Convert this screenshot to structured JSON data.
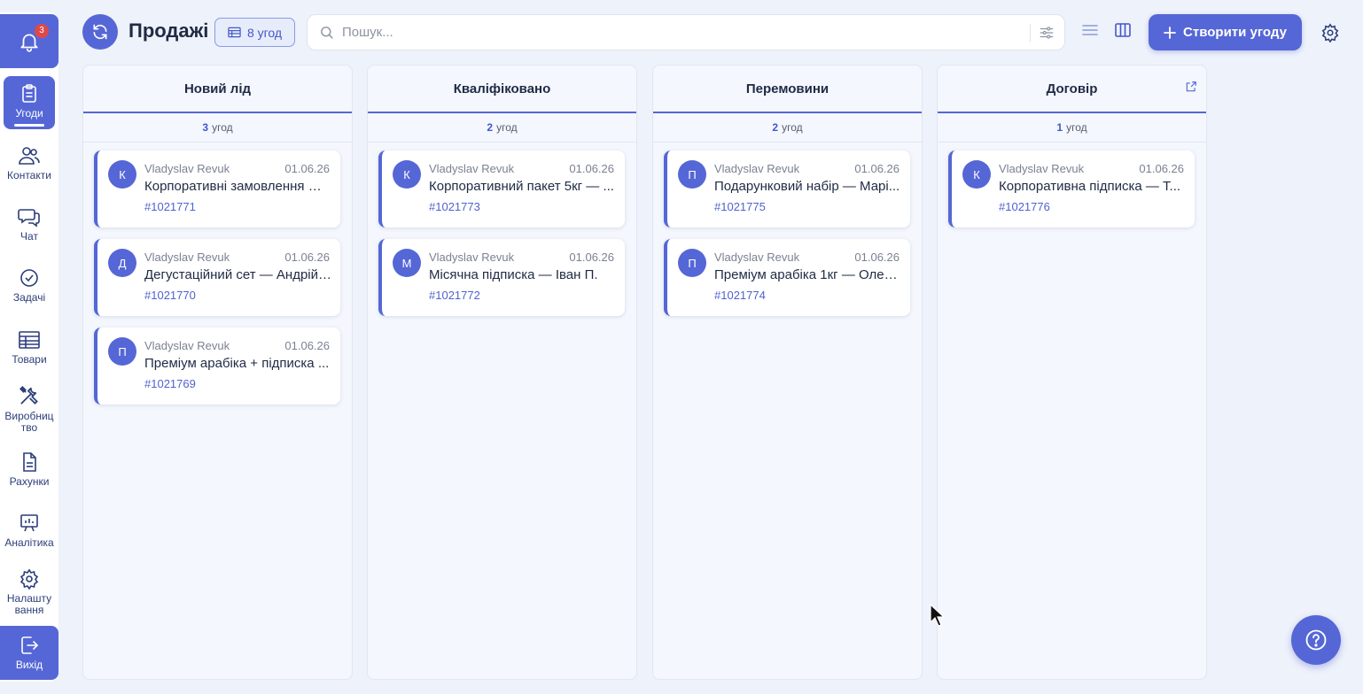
{
  "sidebar": {
    "notifications_count": "3",
    "items": [
      {
        "label": "Угоди"
      },
      {
        "label": "Контакти"
      },
      {
        "label": "Чат"
      },
      {
        "label": "Задачі"
      },
      {
        "label": "Товари"
      },
      {
        "label": "Виробниц тво"
      },
      {
        "label": "Рахунки"
      },
      {
        "label": "Аналітика"
      },
      {
        "label": "Налашту вання"
      }
    ],
    "exit_label": "Вихід"
  },
  "header": {
    "title": "Продажі",
    "deals_count": "8 угод",
    "search_placeholder": "Пошук...",
    "create_label": "Створити угоду"
  },
  "columns": [
    {
      "title": "Новий лід",
      "count": "3",
      "count_unit": "угод",
      "cards": [
        {
          "initial": "К",
          "owner": "Vladyslav Revuk",
          "date": "01.06.26",
          "title": "Корпоративні замовлення — ...",
          "number": "#1021771"
        },
        {
          "initial": "Д",
          "owner": "Vladyslav Revuk",
          "date": "01.06.26",
          "title": "Дегустаційний сет — Андрій ...",
          "number": "#1021770"
        },
        {
          "initial": "П",
          "owner": "Vladyslav Revuk",
          "date": "01.06.26",
          "title": "Преміум арабіка + підписка ...",
          "number": "#1021769"
        }
      ]
    },
    {
      "title": "Кваліфіковано",
      "count": "2",
      "count_unit": "угод",
      "cards": [
        {
          "initial": "К",
          "owner": "Vladyslav Revuk",
          "date": "01.06.26",
          "title": "Корпоративний пакет 5кг — ...",
          "number": "#1021773"
        },
        {
          "initial": "М",
          "owner": "Vladyslav Revuk",
          "date": "01.06.26",
          "title": "Місячна підписка — Іван П.",
          "number": "#1021772"
        }
      ]
    },
    {
      "title": "Перемовини",
      "count": "2",
      "count_unit": "угод",
      "cards": [
        {
          "initial": "П",
          "owner": "Vladyslav Revuk",
          "date": "01.06.26",
          "title": "Подарунковий набір — Марі...",
          "number": "#1021775"
        },
        {
          "initial": "П",
          "owner": "Vladyslav Revuk",
          "date": "01.06.26",
          "title": "Преміум арабіка 1кг — Олен...",
          "number": "#1021774"
        }
      ]
    },
    {
      "title": "Договір",
      "count": "1",
      "count_unit": "угод",
      "cards": [
        {
          "initial": "К",
          "owner": "Vladyslav Revuk",
          "date": "01.06.26",
          "title": "Корпоративна підписка — Т...",
          "number": "#1021776"
        }
      ]
    }
  ],
  "colors": {
    "accent": "#5567d6",
    "background": "#eef2fa",
    "badge": "#e04848"
  }
}
